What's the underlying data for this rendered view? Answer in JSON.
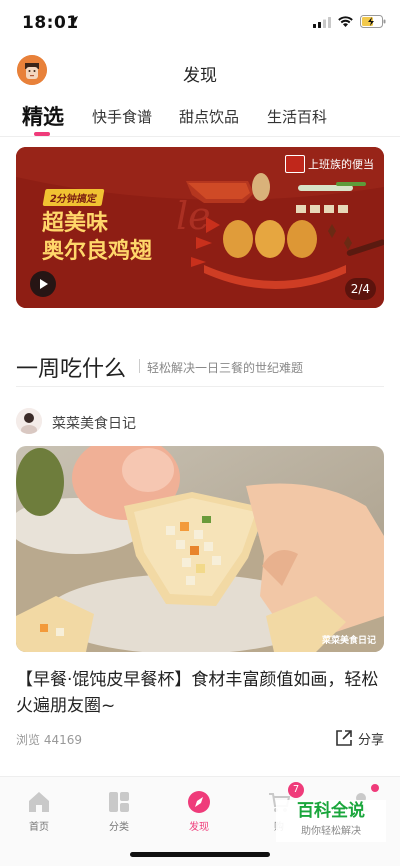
{
  "status_bar": {
    "time": "18:01"
  },
  "header": {
    "title": "发现"
  },
  "tabs": [
    {
      "label": "精选",
      "active": true
    },
    {
      "label": "快手食谱",
      "active": false
    },
    {
      "label": "甜点饮品",
      "active": false
    },
    {
      "label": "生活百科",
      "active": false
    }
  ],
  "banner": {
    "badge": "2分钟搞定",
    "headline_1": "超美味",
    "headline_2": "奥尔良鸡翅",
    "brand": "上班族的便当",
    "counter": "2/4"
  },
  "section": {
    "title": "一周吃什么",
    "subtitle": "轻松解决一日三餐的世纪难题"
  },
  "article": {
    "author": "菜菜美食日记",
    "image_watermark": "菜菜美食日记",
    "title": "【早餐·馄饨皮早餐杯】食材丰富颜值如画，轻松火遍朋友圈~",
    "views": "浏览 44169",
    "share_label": "分享"
  },
  "bottom_nav": {
    "items": [
      {
        "label": "首页",
        "icon": "home-icon"
      },
      {
        "label": "分类",
        "icon": "category-icon"
      },
      {
        "label": "发现",
        "icon": "discover-icon",
        "active": true
      },
      {
        "label": "购",
        "icon": "cart-icon"
      },
      {
        "label": "",
        "icon": "profile-icon"
      }
    ],
    "cart_badge": "7"
  },
  "watermark": {
    "main": "百科全说",
    "sub": "助你轻松解决"
  },
  "colors": {
    "accent": "#ef3b7a",
    "banner_bg": "#8e1e14",
    "banner_text": "#ffd76a"
  }
}
